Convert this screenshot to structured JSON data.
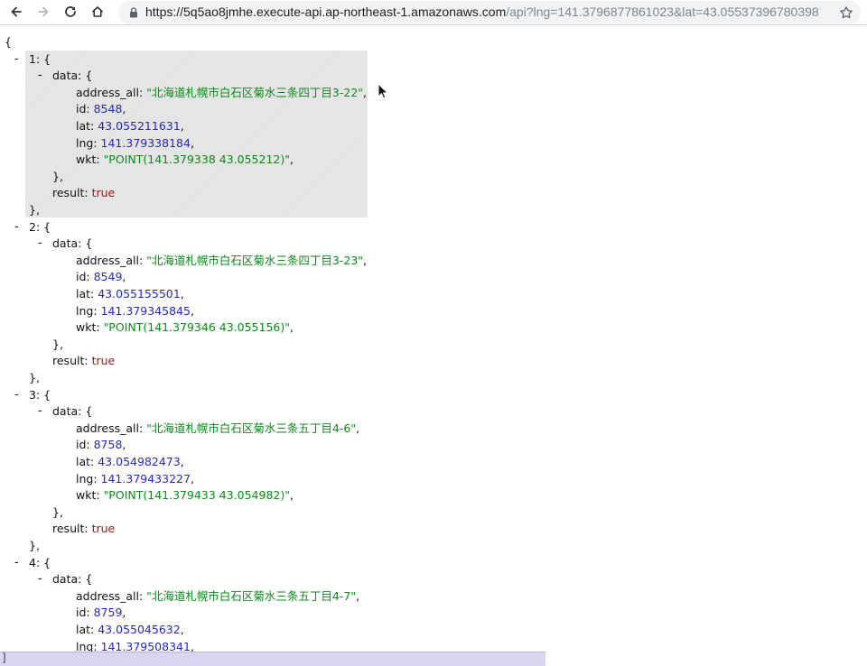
{
  "browser": {
    "url_main": "https://5q5ao8jmhe.execute-api.ap-northeast-1.amazonaws.com",
    "url_path": "/api?lng=141.3796877861023&lat=43.05537396780398",
    "icons": [
      "back-icon",
      "forward-icon",
      "reload-icon",
      "home-icon",
      "lock-icon",
      "star-icon"
    ]
  },
  "json": {
    "open_brace": "{",
    "toggle": "-",
    "items": [
      {
        "key": "1",
        "address_all": "\"北海道札幌市白石区菊水三条四丁目3-22\"",
        "id": "8548",
        "lat": "43.055211631",
        "lng": "141.379338184",
        "wkt": "\"POINT(141.379338 43.055212)\"",
        "result": "true"
      },
      {
        "key": "2",
        "address_all": "\"北海道札幌市白石区菊水三条四丁目3-23\"",
        "id": "8549",
        "lat": "43.055155501",
        "lng": "141.379345845",
        "wkt": "\"POINT(141.379346 43.055156)\"",
        "result": "true"
      },
      {
        "key": "3",
        "address_all": "\"北海道札幌市白石区菊水三条五丁目4-6\"",
        "id": "8758",
        "lat": "43.054982473",
        "lng": "141.379433227",
        "wkt": "\"POINT(141.379433 43.054982)\"",
        "result": "true"
      },
      {
        "key": "4",
        "address_all": "\"北海道札幌市白石区菊水三条五丁目4-7\"",
        "id": "8759",
        "lat": "43.055045632",
        "lng": "141.379508341"
      }
    ],
    "field_keys": {
      "data": "data",
      "address_all": "address_all",
      "id": "id",
      "lat": "lat",
      "lng": "lng",
      "wkt": "wkt",
      "result": "result"
    }
  },
  "status_bar": {
    "text": "]"
  }
}
